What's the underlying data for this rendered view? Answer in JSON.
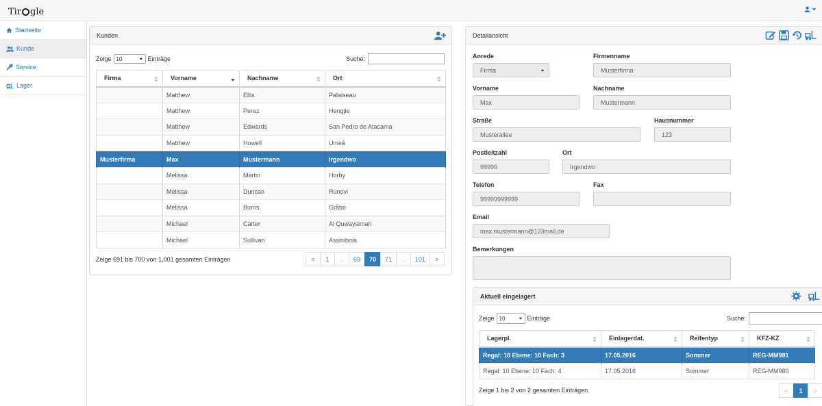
{
  "app": {
    "logo_text_left": "Tir",
    "logo_text_right": "gle",
    "logo_sup": "ʊ"
  },
  "sidebar": {
    "items": [
      {
        "label": "Startseite",
        "icon": "home-icon"
      },
      {
        "label": "Kunde",
        "icon": "users-icon",
        "active": true
      },
      {
        "label": "Service",
        "icon": "wrench-icon"
      },
      {
        "label": "Lager",
        "icon": "forklift-icon"
      }
    ]
  },
  "kunden": {
    "title": "Kunden",
    "show_prefix": "Zeige",
    "page_size": "10",
    "show_suffix": "Einträge",
    "search_label": "Suche:",
    "columns": [
      "Firma",
      "Vorname",
      "Nachname",
      "Ort"
    ],
    "rows": [
      [
        "",
        "Matthew",
        "Ellis",
        "Palaiseau"
      ],
      [
        "",
        "Matthew",
        "Perez",
        "Hengjie"
      ],
      [
        "",
        "Matthew",
        "Edwards",
        "San Pedro de Atacama"
      ],
      [
        "",
        "Matthew",
        "Howell",
        "Umeå"
      ],
      [
        "Musterfirma",
        "Max",
        "Mustermann",
        "Irgendwo"
      ],
      [
        "",
        "Melissa",
        "Martin",
        "Horby"
      ],
      [
        "",
        "Melissa",
        "Duncan",
        "Runovi"
      ],
      [
        "",
        "Melissa",
        "Burns",
        "Gråbo"
      ],
      [
        "",
        "Michael",
        "Carter",
        "Al Quwaysimah"
      ],
      [
        "",
        "Michael",
        "Sullivan",
        "Assiniboia"
      ]
    ],
    "selected_row": 4,
    "info": "Zeige 691 bis 700 von 1,001 gesamten Einträgen",
    "pager": [
      "<",
      "1",
      "...",
      "69",
      "70",
      "71",
      "...",
      "101",
      ">"
    ],
    "active_page": "70"
  },
  "detail": {
    "title": "Detailansicht",
    "labels": {
      "anrede": "Anrede",
      "firmenname": "Firmenname",
      "vorname": "Vorname",
      "nachname": "Nachname",
      "strasse": "Straße",
      "hausnummer": "Hausnummer",
      "plz": "Postleitzahl",
      "ort": "Ort",
      "telefon": "Telefon",
      "fax": "Fax",
      "email": "Email",
      "bemerkungen": "Bemerkungen"
    },
    "values": {
      "anrede": "Firma",
      "firmenname": "Musterfirma",
      "vorname": "Max",
      "nachname": "Mustermann",
      "strasse": "Musterallee",
      "hausnummer": "123",
      "plz": "99999",
      "ort": "Irgendwo",
      "telefon": "99999999999",
      "fax": "",
      "email": "max.mustermann@123mail.de",
      "bemerkungen": ""
    }
  },
  "lager": {
    "title": "Aktuell eingelagert",
    "show_prefix": "Zeige",
    "page_size": "10",
    "show_suffix": "Einträge",
    "search_label": "Suche:",
    "columns": [
      "Lagerpl.",
      "Einlagerdat.",
      "Reifentyp",
      "KFZ-KZ"
    ],
    "rows": [
      [
        "Regal: 10 Ebene: 10 Fach: 3",
        "17.05.2016",
        "Sommer",
        "REG-MM981"
      ],
      [
        "Regal: 10 Ebene: 10 Fach: 4",
        "17.05.2016",
        "Sommer",
        "REG-MM980"
      ]
    ],
    "selected_row": 0,
    "info": "Zeige 1 bis 2 von 2 gesamten Einträgen",
    "pager": [
      "<",
      "1",
      ">"
    ],
    "active_page": "1"
  },
  "colors": {
    "primary": "#337ab7",
    "heading_bg": "#f5f5f5",
    "input_bg": "#eeeeee"
  }
}
